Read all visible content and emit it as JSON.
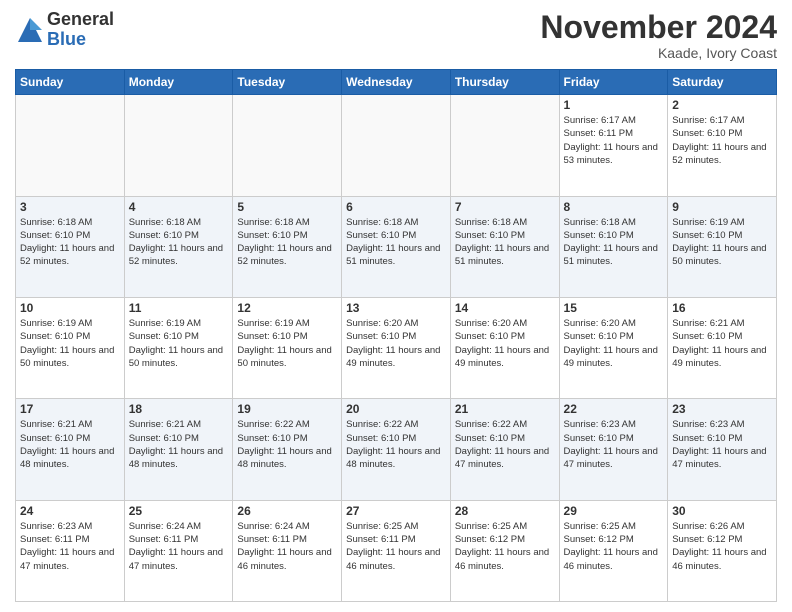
{
  "header": {
    "logo_general": "General",
    "logo_blue": "Blue",
    "month_title": "November 2024",
    "location": "Kaade, Ivory Coast"
  },
  "calendar": {
    "days_of_week": [
      "Sunday",
      "Monday",
      "Tuesday",
      "Wednesday",
      "Thursday",
      "Friday",
      "Saturday"
    ],
    "weeks": [
      [
        {
          "day": "",
          "empty": true
        },
        {
          "day": "",
          "empty": true
        },
        {
          "day": "",
          "empty": true
        },
        {
          "day": "",
          "empty": true
        },
        {
          "day": "",
          "empty": true
        },
        {
          "day": "1",
          "sunrise": "Sunrise: 6:17 AM",
          "sunset": "Sunset: 6:11 PM",
          "daylight": "Daylight: 11 hours and 53 minutes."
        },
        {
          "day": "2",
          "sunrise": "Sunrise: 6:17 AM",
          "sunset": "Sunset: 6:10 PM",
          "daylight": "Daylight: 11 hours and 52 minutes."
        }
      ],
      [
        {
          "day": "3",
          "sunrise": "Sunrise: 6:18 AM",
          "sunset": "Sunset: 6:10 PM",
          "daylight": "Daylight: 11 hours and 52 minutes."
        },
        {
          "day": "4",
          "sunrise": "Sunrise: 6:18 AM",
          "sunset": "Sunset: 6:10 PM",
          "daylight": "Daylight: 11 hours and 52 minutes."
        },
        {
          "day": "5",
          "sunrise": "Sunrise: 6:18 AM",
          "sunset": "Sunset: 6:10 PM",
          "daylight": "Daylight: 11 hours and 52 minutes."
        },
        {
          "day": "6",
          "sunrise": "Sunrise: 6:18 AM",
          "sunset": "Sunset: 6:10 PM",
          "daylight": "Daylight: 11 hours and 51 minutes."
        },
        {
          "day": "7",
          "sunrise": "Sunrise: 6:18 AM",
          "sunset": "Sunset: 6:10 PM",
          "daylight": "Daylight: 11 hours and 51 minutes."
        },
        {
          "day": "8",
          "sunrise": "Sunrise: 6:18 AM",
          "sunset": "Sunset: 6:10 PM",
          "daylight": "Daylight: 11 hours and 51 minutes."
        },
        {
          "day": "9",
          "sunrise": "Sunrise: 6:19 AM",
          "sunset": "Sunset: 6:10 PM",
          "daylight": "Daylight: 11 hours and 50 minutes."
        }
      ],
      [
        {
          "day": "10",
          "sunrise": "Sunrise: 6:19 AM",
          "sunset": "Sunset: 6:10 PM",
          "daylight": "Daylight: 11 hours and 50 minutes."
        },
        {
          "day": "11",
          "sunrise": "Sunrise: 6:19 AM",
          "sunset": "Sunset: 6:10 PM",
          "daylight": "Daylight: 11 hours and 50 minutes."
        },
        {
          "day": "12",
          "sunrise": "Sunrise: 6:19 AM",
          "sunset": "Sunset: 6:10 PM",
          "daylight": "Daylight: 11 hours and 50 minutes."
        },
        {
          "day": "13",
          "sunrise": "Sunrise: 6:20 AM",
          "sunset": "Sunset: 6:10 PM",
          "daylight": "Daylight: 11 hours and 49 minutes."
        },
        {
          "day": "14",
          "sunrise": "Sunrise: 6:20 AM",
          "sunset": "Sunset: 6:10 PM",
          "daylight": "Daylight: 11 hours and 49 minutes."
        },
        {
          "day": "15",
          "sunrise": "Sunrise: 6:20 AM",
          "sunset": "Sunset: 6:10 PM",
          "daylight": "Daylight: 11 hours and 49 minutes."
        },
        {
          "day": "16",
          "sunrise": "Sunrise: 6:21 AM",
          "sunset": "Sunset: 6:10 PM",
          "daylight": "Daylight: 11 hours and 49 minutes."
        }
      ],
      [
        {
          "day": "17",
          "sunrise": "Sunrise: 6:21 AM",
          "sunset": "Sunset: 6:10 PM",
          "daylight": "Daylight: 11 hours and 48 minutes."
        },
        {
          "day": "18",
          "sunrise": "Sunrise: 6:21 AM",
          "sunset": "Sunset: 6:10 PM",
          "daylight": "Daylight: 11 hours and 48 minutes."
        },
        {
          "day": "19",
          "sunrise": "Sunrise: 6:22 AM",
          "sunset": "Sunset: 6:10 PM",
          "daylight": "Daylight: 11 hours and 48 minutes."
        },
        {
          "day": "20",
          "sunrise": "Sunrise: 6:22 AM",
          "sunset": "Sunset: 6:10 PM",
          "daylight": "Daylight: 11 hours and 48 minutes."
        },
        {
          "day": "21",
          "sunrise": "Sunrise: 6:22 AM",
          "sunset": "Sunset: 6:10 PM",
          "daylight": "Daylight: 11 hours and 47 minutes."
        },
        {
          "day": "22",
          "sunrise": "Sunrise: 6:23 AM",
          "sunset": "Sunset: 6:10 PM",
          "daylight": "Daylight: 11 hours and 47 minutes."
        },
        {
          "day": "23",
          "sunrise": "Sunrise: 6:23 AM",
          "sunset": "Sunset: 6:10 PM",
          "daylight": "Daylight: 11 hours and 47 minutes."
        }
      ],
      [
        {
          "day": "24",
          "sunrise": "Sunrise: 6:23 AM",
          "sunset": "Sunset: 6:11 PM",
          "daylight": "Daylight: 11 hours and 47 minutes."
        },
        {
          "day": "25",
          "sunrise": "Sunrise: 6:24 AM",
          "sunset": "Sunset: 6:11 PM",
          "daylight": "Daylight: 11 hours and 47 minutes."
        },
        {
          "day": "26",
          "sunrise": "Sunrise: 6:24 AM",
          "sunset": "Sunset: 6:11 PM",
          "daylight": "Daylight: 11 hours and 46 minutes."
        },
        {
          "day": "27",
          "sunrise": "Sunrise: 6:25 AM",
          "sunset": "Sunset: 6:11 PM",
          "daylight": "Daylight: 11 hours and 46 minutes."
        },
        {
          "day": "28",
          "sunrise": "Sunrise: 6:25 AM",
          "sunset": "Sunset: 6:12 PM",
          "daylight": "Daylight: 11 hours and 46 minutes."
        },
        {
          "day": "29",
          "sunrise": "Sunrise: 6:25 AM",
          "sunset": "Sunset: 6:12 PM",
          "daylight": "Daylight: 11 hours and 46 minutes."
        },
        {
          "day": "30",
          "sunrise": "Sunrise: 6:26 AM",
          "sunset": "Sunset: 6:12 PM",
          "daylight": "Daylight: 11 hours and 46 minutes."
        }
      ]
    ]
  }
}
